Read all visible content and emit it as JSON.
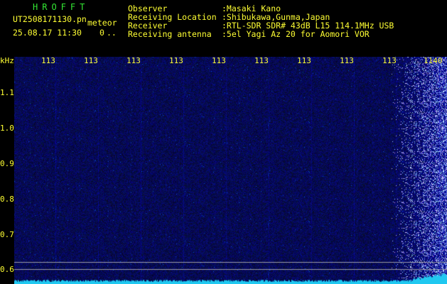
{
  "header": {
    "title": "HROFFT",
    "filename": "UT2508171130.pn",
    "filename_suffix": "meteor",
    "datetime": "25.08.17 11:30",
    "counter": "0",
    "dots": "..",
    "labels": {
      "observer": "Observer",
      "location": "Receiving Location",
      "receiver": "Receiver",
      "antenna": "Receiving antenna"
    },
    "values": {
      "observer": ":Masaki Kano",
      "location": ":Shibukawa,Gunma,Japan",
      "receiver": ":RTL-SDR SDR# 43dB L15 114.1MHz USB",
      "antenna": ":5el Yagi Az 20 for Aomori VOR"
    }
  },
  "axes": {
    "y_unit": "kHz",
    "y_ticks": [
      "1.1",
      "1.0",
      "0.9",
      "0.8",
      "0.7",
      "0.6"
    ],
    "x_ticks": [
      "113",
      "113",
      "113",
      "113",
      "113",
      "113",
      "113",
      "113",
      "113",
      "1140"
    ]
  },
  "colors": {
    "background": "#000000",
    "text_green": "#33e633",
    "text_yellow": "#ffff33",
    "spectrogram": "#0a0a70",
    "noise_floor": "#20c8f0"
  }
}
